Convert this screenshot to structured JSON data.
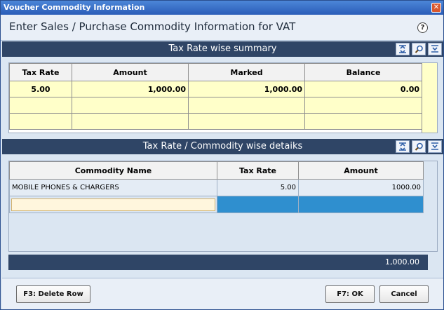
{
  "window": {
    "title": "Voucher Commodity Information",
    "close_glyph": "✕"
  },
  "header": {
    "title": "Enter Sales / Purchase Commodity Information for VAT",
    "help_glyph": "?"
  },
  "summary": {
    "section_title": "Tax Rate wise summary",
    "columns": [
      "Tax Rate",
      "Amount",
      "Marked",
      "Balance"
    ],
    "rows": [
      [
        "5.00",
        "1,000.00",
        "1,000.00",
        "0.00"
      ],
      [
        "",
        "",
        "",
        ""
      ],
      [
        "",
        "",
        "",
        ""
      ]
    ]
  },
  "details": {
    "section_title": "Tax Rate / Commodity wise detaiks",
    "columns": [
      "Commodity Name",
      "Tax Rate",
      "Amount"
    ],
    "rows": [
      [
        "MOBILE PHONES & CHARGERS",
        "5.00",
        "1000.00"
      ]
    ],
    "new_row_value": "",
    "total": "1,000.00"
  },
  "toolbar_icons": [
    "collapse-icon",
    "search-icon",
    "expand-icon"
  ],
  "footer": {
    "delete_row": "F3: Delete Row",
    "ok": "F7: OK",
    "cancel": "Cancel"
  },
  "colors": {
    "section_bar": "#2f4566",
    "summary_cell": "#ffffc9",
    "selection": "#2f8fcf"
  }
}
